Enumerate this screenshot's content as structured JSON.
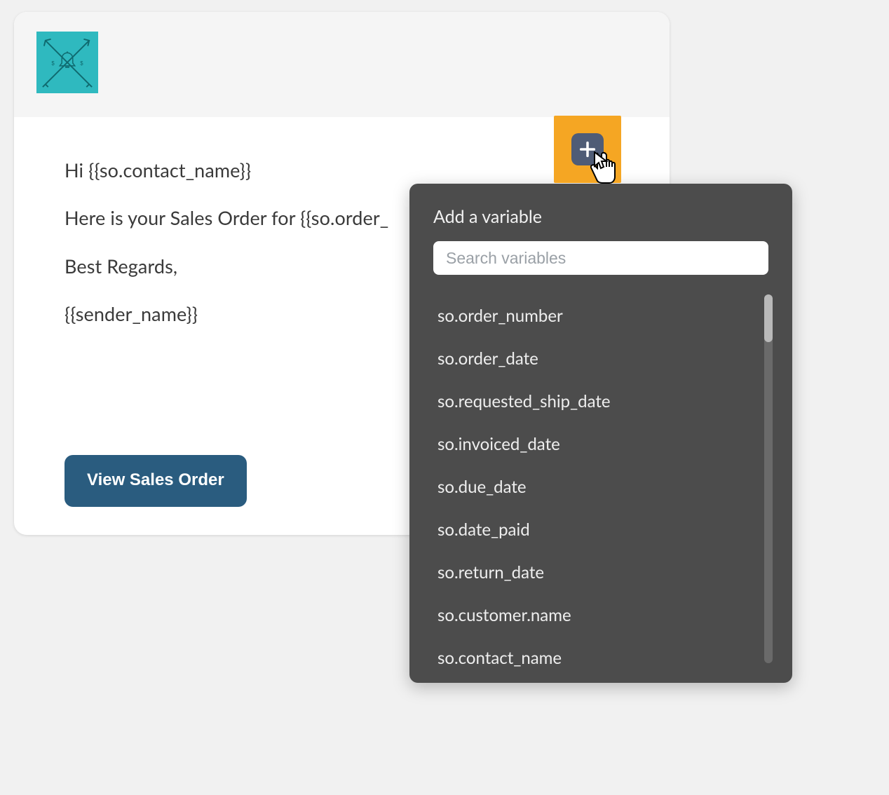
{
  "email": {
    "line1": "Hi {{so.contact_name}}",
    "line2": "Here is your Sales Order for {{so.order_",
    "line3": "Best Regards,",
    "line4": "{{sender_name}}",
    "cta_label": "View Sales Order"
  },
  "popover": {
    "title": "Add a variable",
    "search_placeholder": "Search variables",
    "variables": [
      "so.order_number",
      "so.order_date",
      "so.requested_ship_date",
      "so.invoiced_date",
      "so.due_date",
      "so.date_paid",
      "so.return_date",
      "so.customer.name",
      "so.contact_name"
    ]
  },
  "logo": {
    "left_marker": "$",
    "right_marker": "$"
  }
}
